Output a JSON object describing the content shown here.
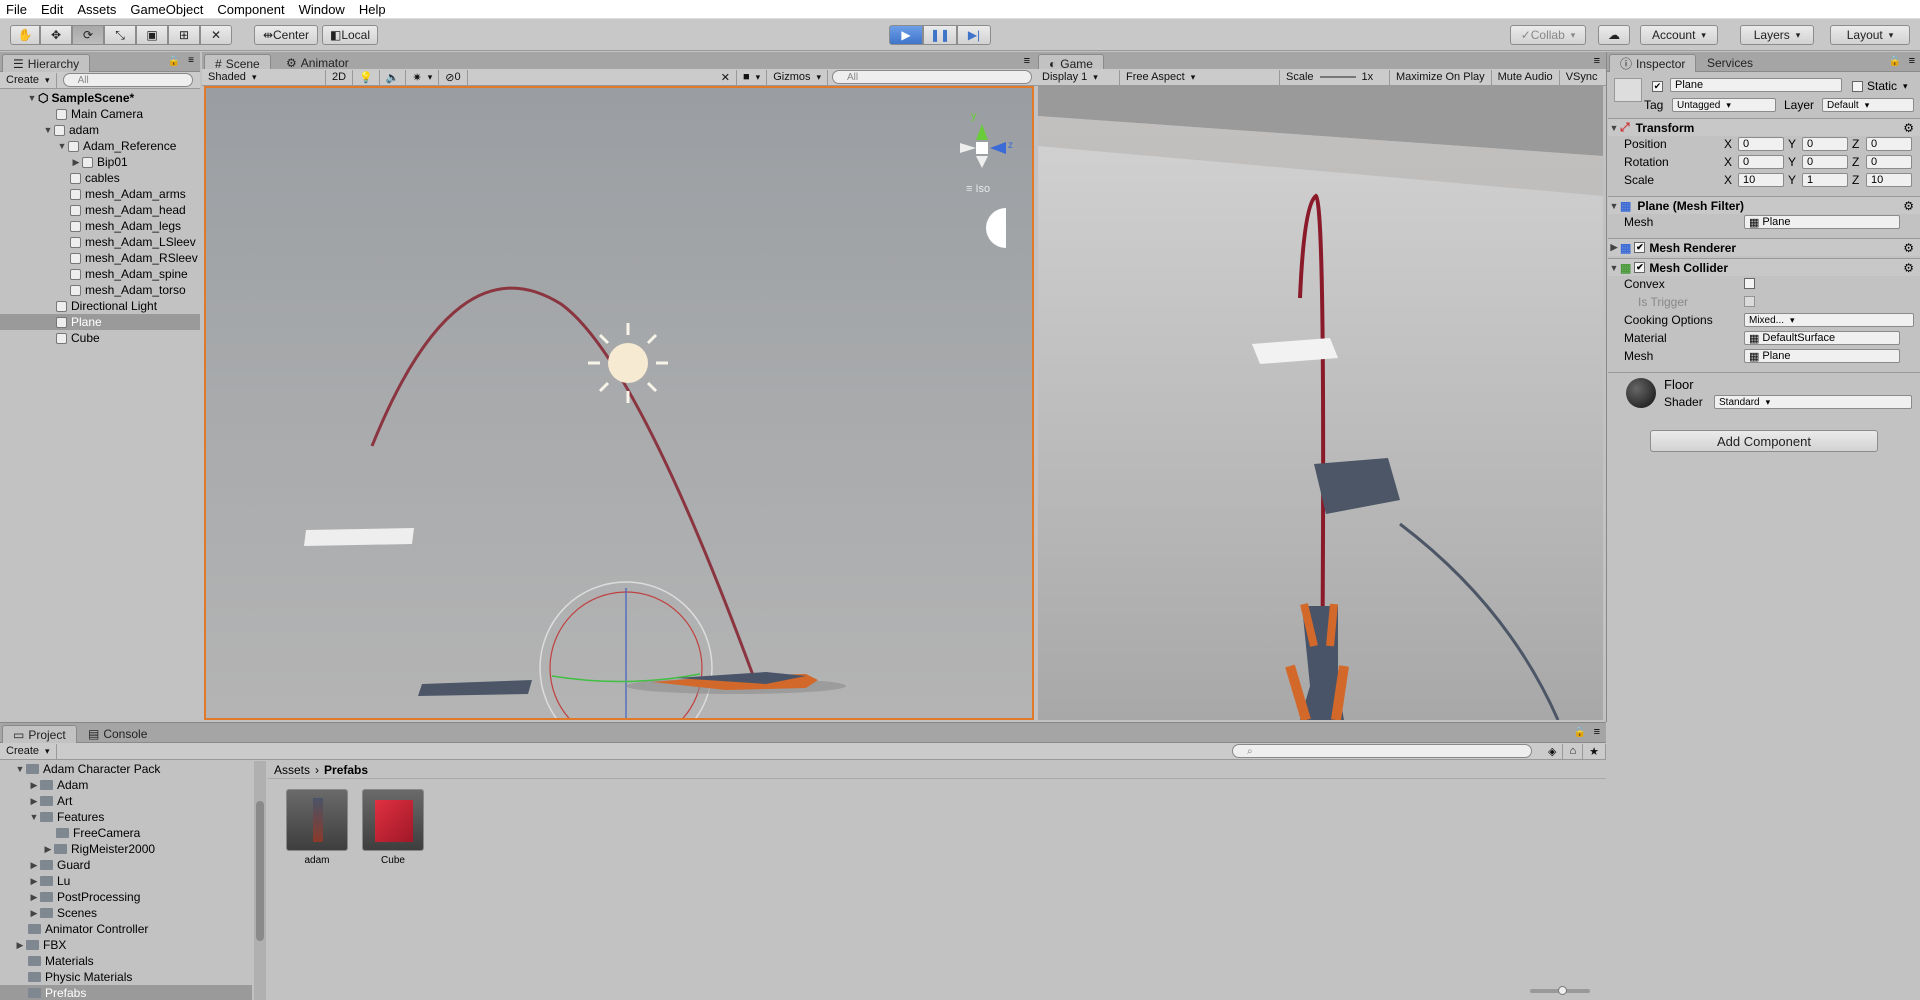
{
  "menu": [
    "File",
    "Edit",
    "Assets",
    "GameObject",
    "Component",
    "Window",
    "Help"
  ],
  "toolbar": {
    "center": "Center",
    "local": "Local",
    "collab": "Collab",
    "account": "Account",
    "layers": "Layers",
    "layout": "Layout"
  },
  "hierarchy": {
    "tab": "Hierarchy",
    "create": "Create",
    "search": "All",
    "scene": "SampleScene*",
    "items": [
      "Main Camera",
      "adam",
      "Adam_Reference",
      "Bip01",
      "cables",
      "mesh_Adam_arms",
      "mesh_Adam_head",
      "mesh_Adam_legs",
      "mesh_Adam_LSleev",
      "mesh_Adam_RSleev",
      "mesh_Adam_spine",
      "mesh_Adam_torso",
      "Directional Light",
      "Plane",
      "Cube"
    ]
  },
  "scene": {
    "tab": "Scene",
    "animator_tab": "Animator",
    "shaded": "Shaded",
    "mode2d": "2D",
    "gizmos": "Gizmos",
    "search": "All",
    "iso": "Iso",
    "zero": "0"
  },
  "game": {
    "tab": "Game",
    "display": "Display 1",
    "aspect": "Free Aspect",
    "scale_label": "Scale",
    "scale_value": "1x",
    "maximize": "Maximize On Play",
    "mute": "Mute Audio",
    "vsync": "VSync"
  },
  "inspector": {
    "tab": "Inspector",
    "services": "Services",
    "name": "Plane",
    "static": "Static",
    "tag_label": "Tag",
    "tag": "Untagged",
    "layer_label": "Layer",
    "layer": "Default",
    "transform": "Transform",
    "position": "Position",
    "rotation": "Rotation",
    "scale": "Scale",
    "pos": [
      "0",
      "0",
      "0"
    ],
    "rot": [
      "0",
      "0",
      "0"
    ],
    "scl": [
      "10",
      "1",
      "10"
    ],
    "mesh_filter": "Plane (Mesh Filter)",
    "mesh_label": "Mesh",
    "mesh_value": "Plane",
    "mesh_renderer": "Mesh Renderer",
    "mesh_collider": "Mesh Collider",
    "convex": "Convex",
    "is_trigger": "Is Trigger",
    "cooking": "Cooking Options",
    "cooking_value": "Mixed...",
    "material_label": "Material",
    "material_value": "DefaultSurface",
    "mesh2_label": "Mesh",
    "mesh2_value": "Plane",
    "floor": "Floor",
    "shader_label": "Shader",
    "shader": "Standard",
    "add_component": "Add Component"
  },
  "project": {
    "tab": "Project",
    "console_tab": "Console",
    "create": "Create",
    "breadcrumb_root": "Assets",
    "breadcrumb_current": "Prefabs",
    "tree": [
      "Adam Character Pack",
      "Adam",
      "Art",
      "Features",
      "FreeCamera",
      "RigMeister2000",
      "Guard",
      "Lu",
      "PostProcessing",
      "Scenes",
      "Animator Controller",
      "FBX",
      "Materials",
      "Physic Materials",
      "Prefabs"
    ],
    "assets": [
      "adam",
      "Cube"
    ]
  }
}
